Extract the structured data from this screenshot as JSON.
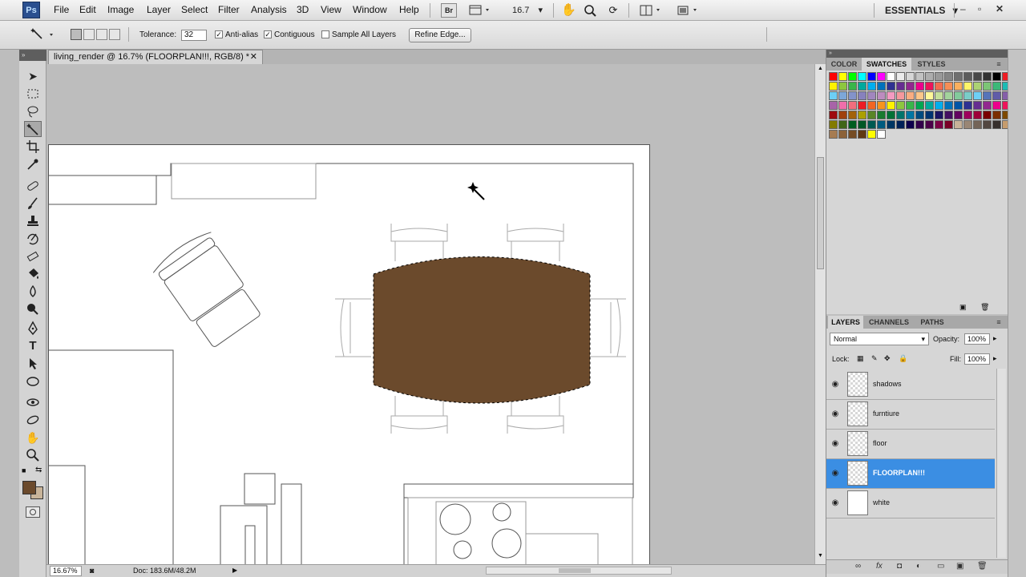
{
  "app": {
    "logo": "Ps",
    "workspace": "ESSENTIALS",
    "zoom_menu": "16.7"
  },
  "menu": {
    "items": [
      "File",
      "Edit",
      "Image",
      "Layer",
      "Select",
      "Filter",
      "Analysis",
      "3D",
      "View",
      "Window",
      "Help"
    ],
    "bridge_label": "Br"
  },
  "options": {
    "tolerance_label": "Tolerance:",
    "tolerance_value": "32",
    "antialias_label": "Anti-alias",
    "antialias_checked": true,
    "contiguous_label": "Contiguous",
    "contiguous_checked": true,
    "sample_all_label": "Sample All Layers",
    "sample_all_checked": false,
    "refine_edge_label": "Refine Edge..."
  },
  "document": {
    "tab_title": "living_render @ 16.7% (FLOORPLAN!!!, RGB/8) *",
    "table_color": "#6b4a2c"
  },
  "status": {
    "zoom": "16.67%",
    "doc_info": "Doc: 183.6M/48.2M"
  },
  "tools": {
    "foreground_color": "#6b4a2c",
    "background_color": "#c8b49a",
    "icons": [
      "move-icon",
      "marquee-icon",
      "lasso-icon",
      "magic-wand-icon",
      "crop-icon",
      "eyedropper-icon",
      "healing-icon",
      "brush-icon",
      "stamp-icon",
      "history-brush-icon",
      "eraser-icon",
      "paint-bucket-icon",
      "blur-icon",
      "dodge-icon",
      "pen-icon",
      "type-icon",
      "path-select-icon",
      "shape-icon",
      "3d-rotate-icon",
      "3d-orbit-icon",
      "hand-icon",
      "zoom-icon"
    ]
  },
  "swatches_panel": {
    "tabs": [
      "COLOR",
      "SWATCHES",
      "STYLES"
    ],
    "active_tab": "SWATCHES",
    "row1": [
      "#ff0000",
      "#ffff00",
      "#00ff00",
      "#00ffff",
      "#0000ff",
      "#ff00ff",
      "#ffffff",
      "#ebebeb",
      "#d6d6d6",
      "#c2c2c2",
      "#adadad",
      "#999999",
      "#858585",
      "#707070",
      "#5c5c5c",
      "#474747",
      "#333333",
      "#000000",
      "#ee1d24",
      "#f26d7d",
      "#f7941d"
    ],
    "rows": [
      [
        "#fff200",
        "#8dc63f",
        "#39b54a",
        "#00a99d",
        "#00aeef",
        "#0072bc",
        "#2e3192",
        "#662d91",
        "#92278f",
        "#ec008c",
        "#ed145b",
        "#f26c4f",
        "#f68e56",
        "#fbaf5d",
        "#fff568",
        "#acd373",
        "#7cc576",
        "#3cb878",
        "#1cbbb4"
      ],
      [
        "#6dcff6",
        "#7da7d9",
        "#8393ca",
        "#8781bd",
        "#a186be",
        "#bd8cbf",
        "#f49ac1",
        "#f5989d",
        "#f9ad81",
        "#fdc689",
        "#fff799",
        "#c4df9b",
        "#a3d39c",
        "#82ca9c",
        "#7accc8",
        "#6ecff6",
        "#5674b9",
        "#605ca8",
        "#855fa8"
      ],
      [
        "#a864a8",
        "#f06eaa",
        "#f26d7d",
        "#ed1c24",
        "#f26522",
        "#f7941d",
        "#fff200",
        "#8dc63f",
        "#39b54a",
        "#00a651",
        "#00a99d",
        "#00aeef",
        "#0072bc",
        "#0054a6",
        "#2e3192",
        "#662d91",
        "#92278f",
        "#ec008c",
        "#ed145b"
      ],
      [
        "#9e0b0f",
        "#a0410d",
        "#a36209",
        "#aba000",
        "#598527",
        "#1a7b30",
        "#007236",
        "#00746b",
        "#0076a3",
        "#004b80",
        "#003471",
        "#1b1464",
        "#440e62",
        "#630460",
        "#9e005d",
        "#9e0039",
        "#790000",
        "#7b2e00",
        "#7d4900"
      ],
      [
        "#827b00",
        "#406618",
        "#005e20",
        "#005826",
        "#005952",
        "#005b7f",
        "#003663",
        "#002157",
        "#0d004c",
        "#32004b",
        "#4b0049",
        "#7b0046",
        "#7a0026",
        "#c7b299",
        "#998675",
        "#736357",
        "#534741",
        "#37302d",
        "#c69c6d"
      ],
      [
        "#a67c52",
        "#8c6239",
        "#754c24",
        "#603913",
        "#fffc00",
        "#ffffff"
      ]
    ]
  },
  "layers_panel": {
    "tabs": [
      "LAYERS",
      "CHANNELS",
      "PATHS"
    ],
    "active_tab": "LAYERS",
    "blend_mode": "Normal",
    "opacity_label": "Opacity:",
    "opacity_value": "100%",
    "lock_label": "Lock:",
    "fill_label": "Fill:",
    "fill_value": "100%",
    "layers": [
      {
        "name": "shadows",
        "selected": false
      },
      {
        "name": "furntiure",
        "selected": false
      },
      {
        "name": "floor",
        "selected": false
      },
      {
        "name": "FLOORPLAN!!!",
        "selected": true
      },
      {
        "name": "white",
        "selected": false
      }
    ]
  }
}
